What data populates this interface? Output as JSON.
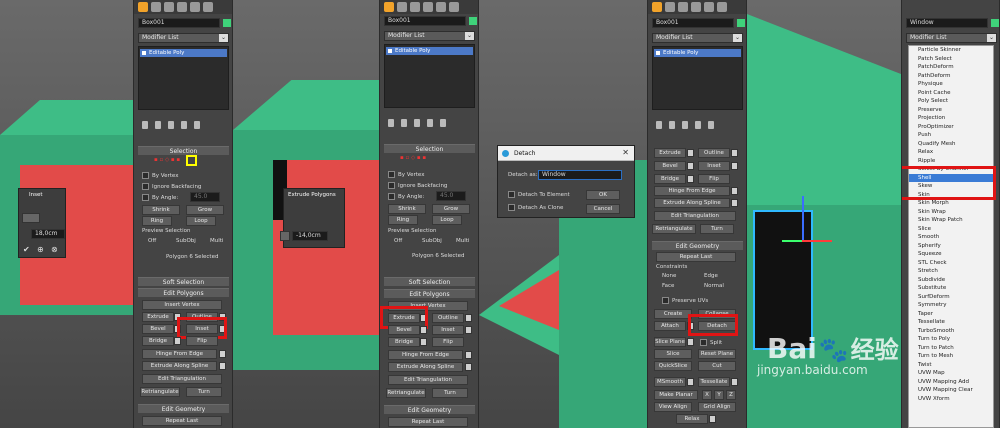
{
  "panel1": {
    "object_name": "Box001",
    "modifier_list": "Modifier List",
    "stack_item": "Editable Poly",
    "selection_header": "Selection",
    "by_vertex": "By Vertex",
    "ignore_backfacing": "Ignore Backfacing",
    "by_angle": "By Angle:",
    "angle_value": "45.0",
    "shrink": "Shrink",
    "grow": "Grow",
    "ring": "Ring",
    "loop": "Loop",
    "preview_header": "Preview Selection",
    "off": "Off",
    "subobj": "SubObj",
    "multi": "Multi",
    "status": "Polygon 6 Selected",
    "soft_selection": "Soft Selection",
    "edit_polygons": "Edit Polygons",
    "insert_vertex": "Insert Vertex",
    "extrude": "Extrude",
    "outline": "Outline",
    "bevel": "Bevel",
    "inset": "Inset",
    "bridge": "Bridge",
    "flip": "Flip",
    "hinge": "Hinge From Edge",
    "extrude_spline": "Extrude Along Spline",
    "edit_triangulation": "Edit Triangulation",
    "retriangulate": "Retriangulate",
    "turn": "Turn",
    "edit_geometry": "Edit Geometry",
    "repeat_last": "Repeat Last"
  },
  "vp1": {
    "caddy_title": "Inset",
    "caddy_value": "18,0cm"
  },
  "vp2": {
    "caddy_title": "Extrude Polygons",
    "caddy_value": "-14,0cm"
  },
  "dialog": {
    "title": "Detach",
    "detach_as_label": "Detach as:",
    "detach_as_value": "Window",
    "to_element": "Detach To Element",
    "as_clone": "Detach As Clone",
    "ok": "OK",
    "cancel": "Cancel"
  },
  "panel3": {
    "object_name": "Box001",
    "modifier_list": "Modifier List",
    "stack_item": "Editable Poly",
    "extrude": "Extrude",
    "outline": "Outline",
    "bevel": "Bevel",
    "inset": "Inset",
    "bridge": "Bridge",
    "flip": "Flip",
    "hinge": "Hinge From Edge",
    "extrude_spline": "Extrude Along Spline",
    "edit_triangulation": "Edit Triangulation",
    "retriangulate": "Retriangulate",
    "turn": "Turn",
    "edit_geometry": "Edit Geometry",
    "repeat_last": "Repeat Last",
    "constraints": "Constraints",
    "none": "None",
    "edge": "Edge",
    "face": "Face",
    "normal": "Normal",
    "preserve_uvs": "Preserve UVs",
    "create": "Create",
    "collapse": "Collapse",
    "attach": "Attach",
    "detach": "Detach",
    "slice_plane": "Slice Plane",
    "split": "Split",
    "slice": "Slice",
    "reset_plane": "Reset Plane",
    "quickslice": "QuickSlice",
    "cut": "Cut",
    "msmooth": "MSmooth",
    "tessellate": "Tessellate",
    "make_planar": "Make Planar",
    "x": "X",
    "y": "Y",
    "z": "Z",
    "view_align": "View Align",
    "grid_align": "Grid Align",
    "relax": "Relax"
  },
  "panel4": {
    "object_name": "Window",
    "menu_items": [
      "Particle Skinner",
      "Patch Select",
      "PatchDeform",
      "PathDeform",
      "Physique",
      "Point Cache",
      "Poly Select",
      "Preserve",
      "Projection",
      "ProOptimizer",
      "Push",
      "Quadify Mesh",
      "Relax",
      "Ripple",
      "Select By Channel",
      "Shell",
      "Skew",
      "Skin",
      "Skin Morph",
      "Skin Wrap",
      "Skin Wrap Patch",
      "Slice",
      "Smooth",
      "Spherify",
      "Squeeze",
      "STL Check",
      "Stretch",
      "Subdivide",
      "Substitute",
      "SurfDeform",
      "Symmetry",
      "Taper",
      "Tessellate",
      "TurboSmooth",
      "Turn to Poly",
      "Turn to Patch",
      "Turn to Mesh",
      "Twist",
      "UVW Map",
      "UVW Mapping Add",
      "UVW Mapping Clear",
      "UVW Xform"
    ],
    "highlighted": "Shell"
  },
  "watermark": {
    "brand": "Bai",
    "brand2": "经验",
    "url": "jingyan.baidu.com"
  }
}
